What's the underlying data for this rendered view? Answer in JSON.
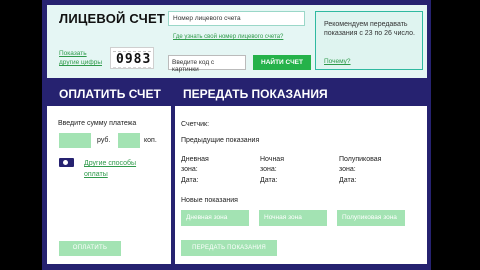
{
  "account": {
    "title": "ЛИЦЕВОЙ СЧЕТ",
    "show_digits_link": "Показать другие цифры",
    "captcha_code": "0983",
    "account_placeholder": "Номер лицевого счета",
    "where_link": "Где узнать свой номер лицевого счета?",
    "captcha_placeholder": "Введите код с картинки",
    "find_button": "НАЙТИ СЧЕТ"
  },
  "recommendation": {
    "text": "Рекомендуем передавать показания с 23 по 26 число.",
    "why_link": "Почему?"
  },
  "pay": {
    "header": "ОПЛАТИТЬ СЧЕТ",
    "sum_label": "Введите сумму платежа",
    "rub_label": "руб.",
    "kop_label": "коп.",
    "other_ways_link": "Другие способы оплаты",
    "button": "ОПЛАТИТЬ"
  },
  "submit": {
    "header": "ПЕРЕДАТЬ ПОКАЗАНИЯ",
    "meter_label": "Счетчик:",
    "previous_label": "Предыдущие показания",
    "zones": [
      {
        "name": "Дневная зона:",
        "date_label": "Дата:",
        "new_placeholder": "Дневная зона"
      },
      {
        "name": "Ночная зона:",
        "date_label": "Дата:",
        "new_placeholder": "Ночная зона"
      },
      {
        "name": "Полупиковая зона:",
        "date_label": "Дата:",
        "new_placeholder": "Полупиковая зона"
      }
    ],
    "new_label": "Новые показания",
    "button": "ПЕРЕДАТЬ ПОКАЗАНИЯ"
  }
}
